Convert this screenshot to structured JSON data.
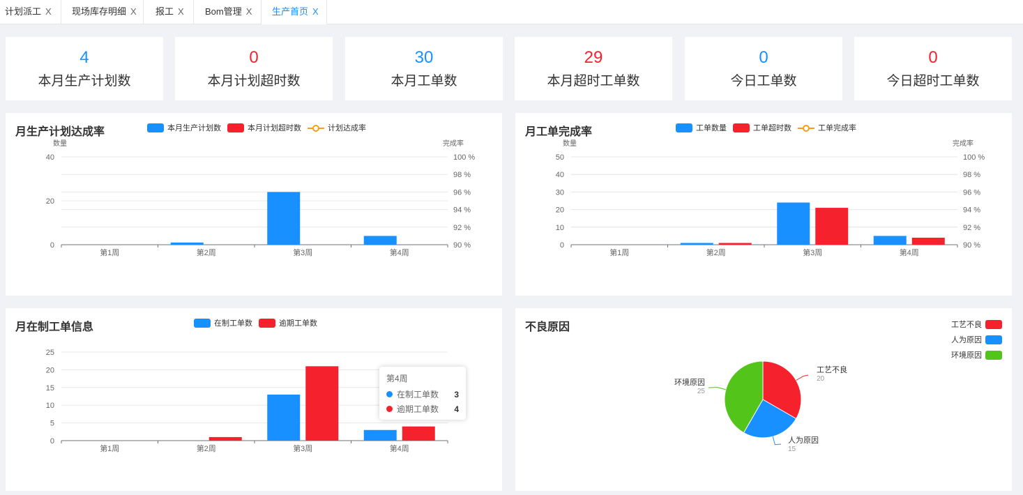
{
  "tabs": [
    {
      "label": "计划派工",
      "active": false
    },
    {
      "label": "现场库存明细",
      "active": false
    },
    {
      "label": "报工",
      "active": false
    },
    {
      "label": "Bom管理",
      "active": false
    },
    {
      "label": "生产首页",
      "active": true
    }
  ],
  "close_glyph": "X",
  "stats": [
    {
      "value": "4",
      "label": "本月生产计划数"
    },
    {
      "value": "0",
      "label": "本月计划超时数"
    },
    {
      "value": "30",
      "label": "本月工单数"
    },
    {
      "value": "29",
      "label": "本月超时工单数"
    },
    {
      "value": "0",
      "label": "今日工单数"
    },
    {
      "value": "0",
      "label": "今日超时工单数"
    }
  ],
  "colors": {
    "blue": "#1890ff",
    "red": "#f5222d",
    "green": "#52c41a",
    "orange": "#fa9d14"
  },
  "chart_data": [
    {
      "type": "bar",
      "title": "月生产计划达成率",
      "categories": [
        "第1周",
        "第2周",
        "第3周",
        "第4周"
      ],
      "series": [
        {
          "name": "本月生产计划数",
          "values": [
            0,
            1,
            24,
            4
          ]
        },
        {
          "name": "本月计划超时数",
          "values": [
            0,
            0,
            0,
            0
          ]
        },
        {
          "name": "计划达成率",
          "values": [],
          "type": "line"
        }
      ],
      "ylabel": "数量",
      "y2label": "完成率",
      "ylim": [
        0,
        40
      ],
      "yticks": [
        "0",
        "20",
        "40"
      ],
      "y2lim": [
        90,
        100
      ],
      "y2ticks": [
        "90 %",
        "92 %",
        "94 %",
        "96 %",
        "98 %",
        "100 %"
      ],
      "grid": true,
      "legend": "top"
    },
    {
      "type": "bar",
      "title": "月工单完成率",
      "categories": [
        "第1周",
        "第2周",
        "第3周",
        "第4周"
      ],
      "series": [
        {
          "name": "工单数量",
          "values": [
            0,
            1,
            24,
            5
          ]
        },
        {
          "name": "工单超时数",
          "values": [
            0,
            1,
            21,
            4
          ]
        },
        {
          "name": "工单完成率",
          "values": [],
          "type": "line"
        }
      ],
      "ylabel": "数量",
      "y2label": "完成率",
      "ylim": [
        0,
        50
      ],
      "yticks": [
        "0",
        "10",
        "20",
        "30",
        "40",
        "50"
      ],
      "y2lim": [
        90,
        100
      ],
      "y2ticks": [
        "90 %",
        "92 %",
        "94 %",
        "96 %",
        "98 %",
        "100 %"
      ],
      "grid": true,
      "legend": "top"
    },
    {
      "type": "bar",
      "title": "月在制工单信息",
      "categories": [
        "第1周",
        "第2周",
        "第3周",
        "第4周"
      ],
      "series": [
        {
          "name": "在制工单数",
          "values": [
            0,
            0,
            13,
            3
          ]
        },
        {
          "name": "逾期工单数",
          "values": [
            0,
            1,
            21,
            4
          ]
        }
      ],
      "ylim": [
        0,
        25
      ],
      "yticks": [
        "0",
        "5",
        "10",
        "15",
        "20",
        "25"
      ],
      "grid": true,
      "legend": "top"
    },
    {
      "type": "pie",
      "title": "不良原因",
      "slices": [
        {
          "name": "工艺不良",
          "value": 20
        },
        {
          "name": "人为原因",
          "value": 15
        },
        {
          "name": "环境原因",
          "value": 25
        }
      ],
      "legend": "top-right"
    }
  ],
  "tooltip": {
    "title": "第4周",
    "rows": [
      {
        "name": "在制工单数",
        "value": "3"
      },
      {
        "name": "逾期工单数",
        "value": "4"
      }
    ]
  }
}
